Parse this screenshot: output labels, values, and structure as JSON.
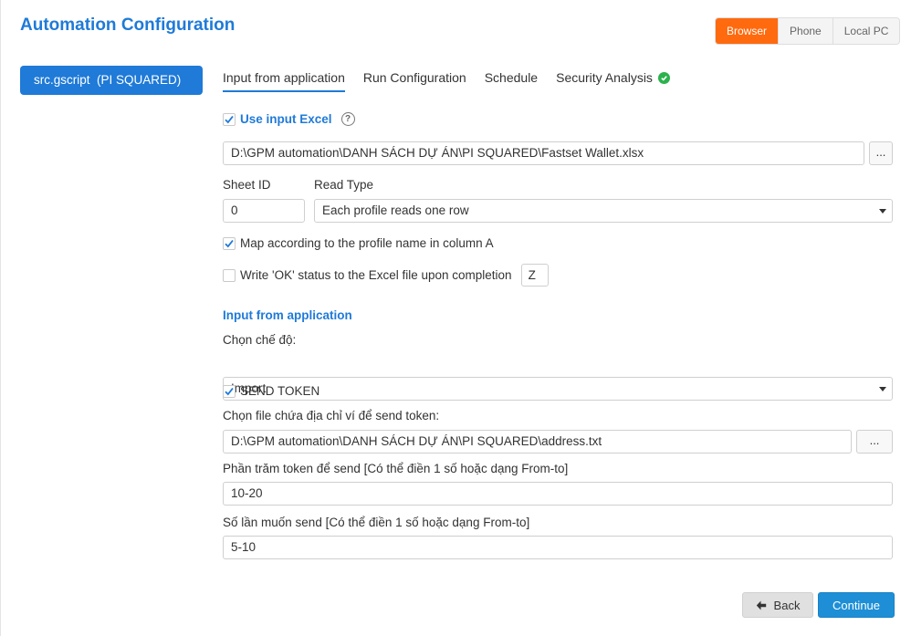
{
  "header": {
    "title": "Automation Configuration",
    "environments": [
      "Browser",
      "Phone",
      "Local PC"
    ],
    "active_environment": "Browser"
  },
  "sidebar": {
    "script_name": "src.gscript",
    "project": "(PI SQUARED)"
  },
  "tabs": [
    {
      "label": "Input from application",
      "active": true
    },
    {
      "label": "Run Configuration",
      "active": false
    },
    {
      "label": "Schedule",
      "active": false
    },
    {
      "label": "Security Analysis",
      "active": false,
      "status_icon": "check-circle-icon"
    }
  ],
  "excel": {
    "use_input_label": "Use input Excel",
    "use_input_checked": true,
    "file_path": "D:\\GPM automation\\DANH SÁCH DỰ ÁN\\PI SQUARED\\Fastset Wallet.xlsx",
    "browse_label": "...",
    "sheet_id_label": "Sheet ID",
    "sheet_id_value": "0",
    "read_type_label": "Read Type",
    "read_type_value": "Each profile reads one row",
    "map_label": "Map according to the profile name in column A",
    "map_checked": true,
    "write_ok_label": "Write 'OK' status to the Excel file upon completion",
    "write_ok_checked": false,
    "write_ok_column": "Z"
  },
  "app_input": {
    "section_title": "Input from application",
    "mode_label": "Chọn chế độ:",
    "mode_value": "Import",
    "send_token_label": "SEND TOKEN",
    "send_token_checked": true,
    "address_file_label": "Chọn file chứa địa chỉ ví để send token:",
    "address_file_path": "D:\\GPM automation\\DANH SÁCH DỰ ÁN\\PI SQUARED\\address.txt",
    "browse_label": "...",
    "percent_label": "Phần trăm token để send [Có thể điền 1 số hoặc dạng From-to]",
    "percent_value": "10-20",
    "times_label": "Số lần muốn send [Có thể điền 1 số hoặc dạng From-to]",
    "times_value": "5-10"
  },
  "footer": {
    "back_label": "Back",
    "continue_label": "Continue"
  },
  "colors": {
    "accent": "#1f7ad8",
    "active_env": "#ff6a0e",
    "continue": "#1e8fd6",
    "success": "#2bb24c"
  }
}
